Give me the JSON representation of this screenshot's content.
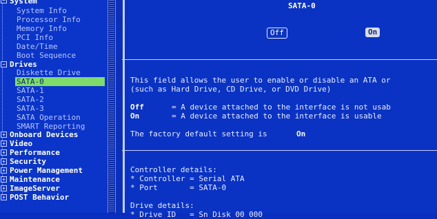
{
  "menu": {
    "system": "System",
    "system_items": [
      "System Info",
      "Processor Info",
      "Memory Info",
      "PCI Info",
      "Date/Time",
      "Boot Sequence"
    ],
    "drives": "Drives",
    "drives_items": [
      "Diskette Drive",
      "SATA-0",
      "SATA-1",
      "SATA-2",
      "SATA-3",
      "SATA Operation",
      "SMART Reporting"
    ],
    "categories": [
      "Onboard Devices",
      "Video",
      "Performance",
      "Security",
      "Power Management",
      "Maintenance",
      "ImageServer",
      "POST Behavior"
    ],
    "selected": "SATA-0"
  },
  "panel": {
    "title": "SATA-0",
    "off_label": "Off",
    "on_label": "On",
    "desc_line1": "This field allows the user to enable or disable an ATA or",
    "desc_line2": "(such as Hard Drive, CD Drive, or DVD Drive)",
    "off_key": "Off",
    "off_desc": "= A device attached to the interface is not usab",
    "on_key": "On",
    "on_desc": "= A device attached to the interface is usable",
    "default_prefix": "The factory default setting is",
    "default_value": "On",
    "controller_heading": "Controller details:",
    "controller_line1": "* Controller = Serial ATA",
    "controller_line2": "* Port       = SATA-0",
    "drive_heading": "Drive details:",
    "drive_line1": "* Drive ID   = Sn Disk 00 000"
  },
  "colors": {
    "background": "#0a2fbf",
    "selection": "#7fdc6a",
    "text": "#e8ecff"
  }
}
